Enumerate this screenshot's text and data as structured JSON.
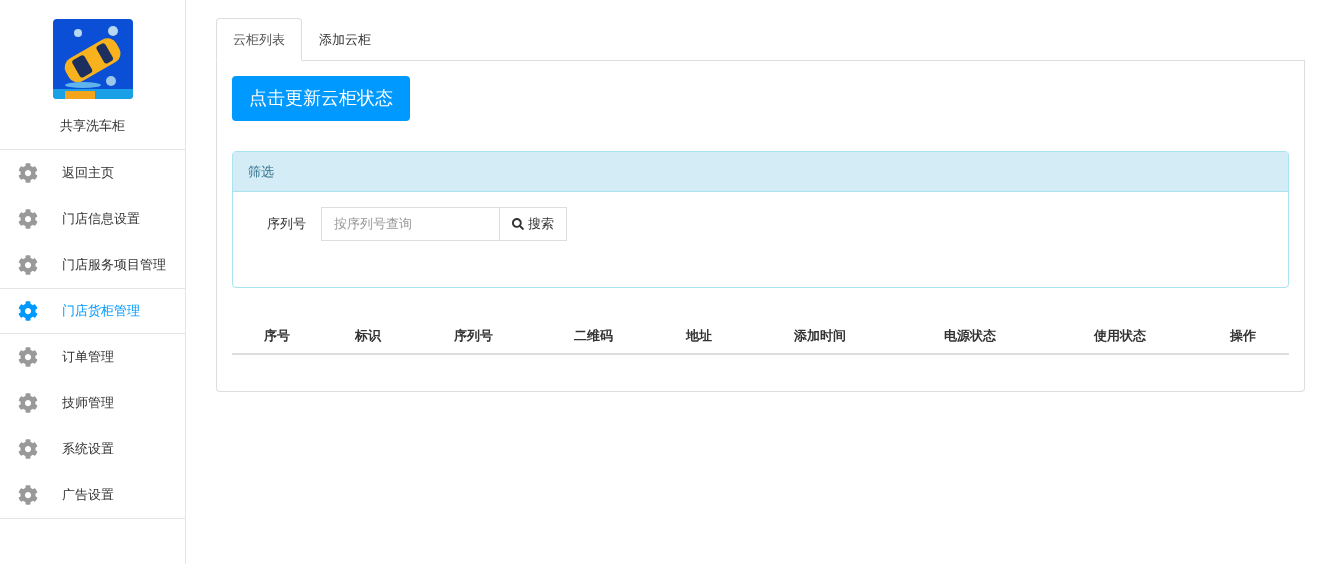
{
  "sidebar": {
    "app_name": "共享洗车柜",
    "items": [
      {
        "label": "返回主页",
        "selected": false
      },
      {
        "label": "门店信息设置",
        "selected": false
      },
      {
        "label": "门店服务项目管理",
        "selected": false
      },
      {
        "label": "门店货柜管理",
        "selected": true
      },
      {
        "label": "订单管理",
        "selected": false
      },
      {
        "label": "技师管理",
        "selected": false
      },
      {
        "label": "系统设置",
        "selected": false
      },
      {
        "label": "广告设置",
        "selected": false
      }
    ]
  },
  "tabs": [
    {
      "label": "云柜列表",
      "selected": true
    },
    {
      "label": "添加云柜",
      "selected": false
    }
  ],
  "refresh_button": "点击更新云柜状态",
  "filter": {
    "title": "筛选",
    "field_label": "序列号",
    "placeholder": "按序列号查询",
    "search_button": "搜索"
  },
  "table": {
    "columns": [
      "序号",
      "标识",
      "序列号",
      "二维码",
      "地址",
      "添加时间",
      "电源状态",
      "使用状态",
      "操作"
    ]
  }
}
